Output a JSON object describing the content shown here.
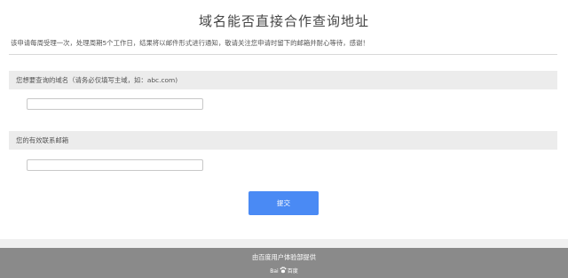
{
  "form": {
    "title": "域名能否直接合作查询地址",
    "notice": "该申请每周受理一次，处理周期5个工作日，结果将以邮件形式进行通知，敬请关注您申请时留下的邮箱并耐心等待，感谢！",
    "domain_section_label": "您想要查询的域名（请务必仅填写主域，如：abc.com)",
    "domain_input_value": "",
    "email_section_label": "您的有效联系邮箱",
    "email_input_value": "",
    "submit_label": "提交"
  },
  "footer": {
    "provider_text": "由百度用户体验部提供",
    "logo_left": "Bai",
    "logo_right": "百度",
    "logo_icon": "baidu-paw-icon"
  },
  "colors": {
    "submit_button": "#4a8af4",
    "section_bar": "#ececec",
    "footer_bg": "#8a8a8a"
  }
}
